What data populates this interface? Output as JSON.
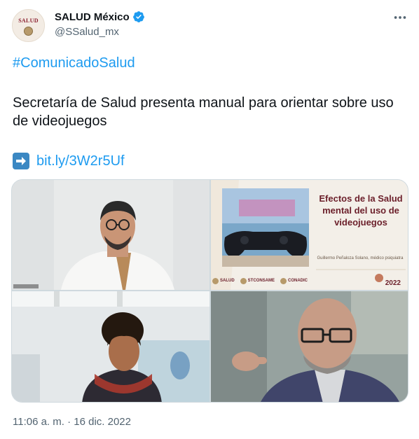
{
  "author": {
    "display_name": "SALUD México",
    "handle": "@SSalud_mx",
    "avatar_text": "SALUD",
    "verified": true
  },
  "tweet": {
    "hashtag": "#ComunicadoSalud",
    "body": "Secretaría de Salud presenta manual para orientar sobre uso de videojuegos",
    "link_arrow": "➡️",
    "link": "bit.ly/3W2r5Uf",
    "timestamp": "11:06 a. m. · 16 dic. 2022"
  },
  "media": {
    "slide": {
      "title": "Efectos de la Salud mental del uso de videojuegos",
      "author": "Guillermo Peñaloza Solano, médico psiquiatra",
      "logos": [
        "SALUD",
        "STCONSAME",
        "CONADIC"
      ],
      "year": "2022"
    }
  },
  "colors": {
    "link": "#1d9bf0",
    "verified": "#1d9bf0",
    "secondary_text": "#536471",
    "border": "#cfd9de"
  },
  "icons": {
    "verified": "verified-badge-icon",
    "more": "more-options-icon",
    "arrow": "right-arrow-emoji-icon"
  }
}
